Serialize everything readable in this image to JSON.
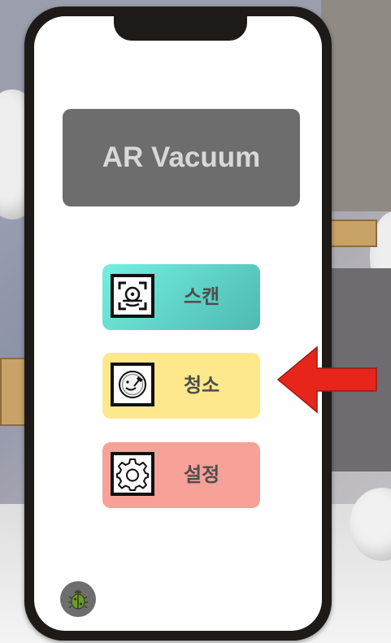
{
  "app": {
    "title": "AR Vacuum"
  },
  "menu": {
    "items": [
      {
        "label": "스캔",
        "icon": "face-scan-icon",
        "color": "#5fd6cb"
      },
      {
        "label": "청소",
        "icon": "broom-smile-icon",
        "color": "#fde98b"
      },
      {
        "label": "설정",
        "icon": "gear-icon",
        "color": "#f7a199"
      }
    ]
  },
  "debug": {
    "icon": "bug-icon"
  },
  "annotation": {
    "arrow_color": "#e8251b",
    "arrow_target": "청소"
  }
}
